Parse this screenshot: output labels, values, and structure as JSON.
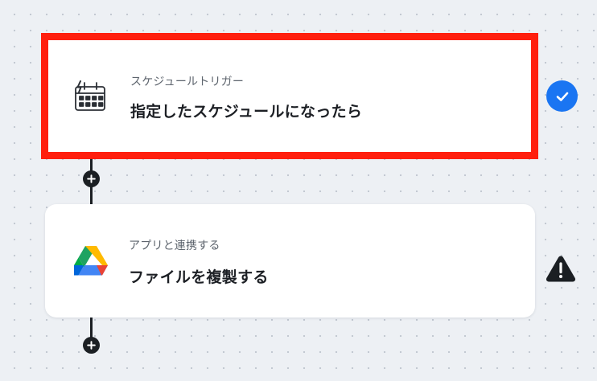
{
  "flow": {
    "steps": [
      {
        "kind": "スケジュールトリガー",
        "title": "指定したスケジュールになったら",
        "icon": "schedule-calendar-icon",
        "status": "check-circle-icon",
        "selected": true
      },
      {
        "kind": "アプリと連携する",
        "title": "ファイルを複製する",
        "icon": "google-drive-icon",
        "status": "warning-triangle-icon",
        "selected": false
      }
    ],
    "add_step_icon": "plus-icon"
  },
  "colors": {
    "canvas_background": "#edf0f4",
    "canvas_dots": "#c3c9d2",
    "selection_border": "#ff1f0e",
    "status_ok": "#1a75f2",
    "status_warning": "#1b1f23",
    "connector": "#1b1f23",
    "drive_green": "#1ea362",
    "drive_yellow": "#ffba00",
    "drive_blue": "#4285f4"
  }
}
